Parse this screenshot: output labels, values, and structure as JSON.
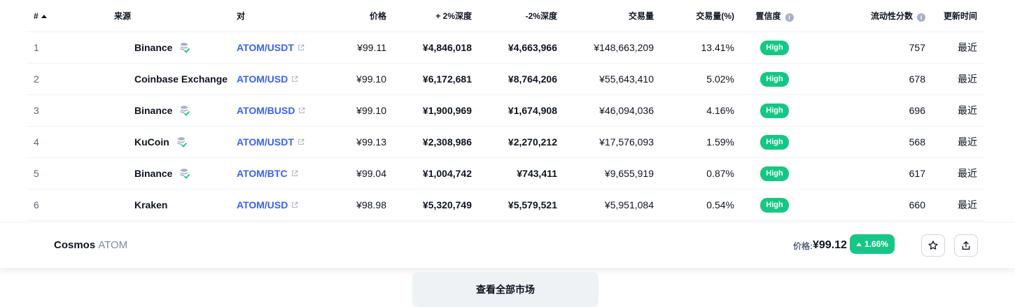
{
  "columns": {
    "rank": "#",
    "source": "来源",
    "pair": "对",
    "price": "价格",
    "depth_plus": "+ 2%深度",
    "depth_minus": "-2%深度",
    "volume": "交易量",
    "volume_pct": "交易量(%)",
    "confidence": "置信度",
    "liquidity": "流动性分数",
    "updated": "更新时间"
  },
  "rows": [
    {
      "rank": "1",
      "source": "Binance",
      "verified": true,
      "pair": "ATOM/USDT",
      "price": "¥99.11",
      "depth_plus": "¥4,846,018",
      "depth_minus": "¥4,663,966",
      "volume": "¥148,663,209",
      "volume_pct": "13.41%",
      "confidence": "High",
      "liquidity": "757",
      "updated": "最近"
    },
    {
      "rank": "2",
      "source": "Coinbase Exchange",
      "verified": false,
      "pair": "ATOM/USD",
      "price": "¥99.10",
      "depth_plus": "¥6,172,681",
      "depth_minus": "¥8,764,206",
      "volume": "¥55,643,410",
      "volume_pct": "5.02%",
      "confidence": "High",
      "liquidity": "678",
      "updated": "最近"
    },
    {
      "rank": "3",
      "source": "Binance",
      "verified": true,
      "pair": "ATOM/BUSD",
      "price": "¥99.10",
      "depth_plus": "¥1,900,969",
      "depth_minus": "¥1,674,908",
      "volume": "¥46,094,036",
      "volume_pct": "4.16%",
      "confidence": "High",
      "liquidity": "696",
      "updated": "最近"
    },
    {
      "rank": "4",
      "source": "KuCoin",
      "verified": true,
      "pair": "ATOM/USDT",
      "price": "¥99.13",
      "depth_plus": "¥2,308,986",
      "depth_minus": "¥2,270,212",
      "volume": "¥17,576,093",
      "volume_pct": "1.59%",
      "confidence": "High",
      "liquidity": "568",
      "updated": "最近"
    },
    {
      "rank": "5",
      "source": "Binance",
      "verified": true,
      "pair": "ATOM/BTC",
      "price": "¥99.04",
      "depth_plus": "¥1,004,742",
      "depth_minus": "¥743,411",
      "volume": "¥9,655,919",
      "volume_pct": "0.87%",
      "confidence": "High",
      "liquidity": "617",
      "updated": "最近"
    },
    {
      "rank": "6",
      "source": "Kraken",
      "verified": false,
      "pair": "ATOM/USD",
      "price": "¥98.98",
      "depth_plus": "¥5,320,749",
      "depth_minus": "¥5,579,521",
      "volume": "¥5,951,084",
      "volume_pct": "0.54%",
      "confidence": "High",
      "liquidity": "660",
      "updated": "最近"
    }
  ],
  "sticky_bar": {
    "coin_name": "Cosmos",
    "coin_symbol": "ATOM",
    "price_label": "价格:",
    "price": "¥99.12",
    "change": "1.66%",
    "star_icon": "star-icon",
    "share_icon": "share-icon"
  },
  "view_all_label": "查看全部市场",
  "colors": {
    "accent_link": "#3861fb",
    "positive": "#16c784",
    "text": "#0d1421",
    "muted": "#58667e"
  }
}
